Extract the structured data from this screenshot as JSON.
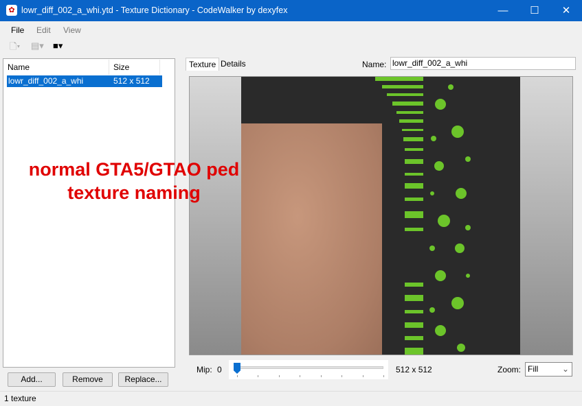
{
  "window": {
    "title": "lowr_diff_002_a_whi.ytd - Texture Dictionary - CodeWalker by dexyfex",
    "minimize": "—",
    "maximize": "☐",
    "close": "✕"
  },
  "menu": [
    "File",
    "Edit",
    "View"
  ],
  "toolbar": {
    "new_icon": "new-file-icon",
    "open_icon": "open-icon",
    "save_icon": "save-icon"
  },
  "list": {
    "columns": [
      "Name",
      "Size"
    ],
    "rows": [
      {
        "name": "lowr_diff_002_a_whi",
        "size": "512 x 512"
      }
    ]
  },
  "buttons": {
    "add": "Add...",
    "remove": "Remove",
    "replace": "Replace..."
  },
  "status": "1 texture",
  "tabs": [
    "Texture",
    "Details"
  ],
  "name_label": "Name:",
  "name_value": "lowr_diff_002_a_whi",
  "annotation": [
    "normal GTA5/GTAO ped",
    "texture naming"
  ],
  "mip": {
    "label": "Mip:",
    "value": "0",
    "level": 0,
    "max": 7,
    "size": "512 x 512"
  },
  "zoom": {
    "label": "Zoom:",
    "value": "Fill"
  },
  "colors": {
    "accent": "#0a6fd0",
    "annotation": "#e00000",
    "texture_green": "#6cc42a"
  }
}
